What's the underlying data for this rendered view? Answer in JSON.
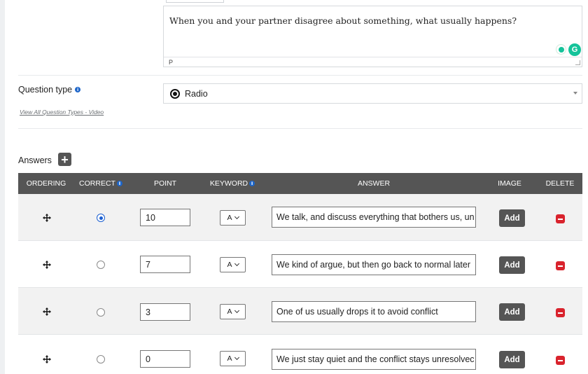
{
  "editor": {
    "content": "When you and your partner disagree about something, what usually happens?",
    "status_path": "P"
  },
  "question_type": {
    "label": "Question type",
    "link": "View All Question Types - Video",
    "selected": "Radio"
  },
  "answers": {
    "title": "Answers",
    "columns": {
      "ordering": "ORDERING",
      "correct": "CORRECT",
      "point": "POINT",
      "keyword": "KEYWORD",
      "answer": "ANSWER",
      "image": "IMAGE",
      "delete": "DELETE"
    },
    "image_button_label": "Add",
    "rows": [
      {
        "correct": true,
        "point": "10",
        "keyword": "A",
        "answer": "We talk, and discuss everything that bothers us, un"
      },
      {
        "correct": false,
        "point": "7",
        "keyword": "A",
        "answer": "We kind of argue, but then go back to normal later"
      },
      {
        "correct": false,
        "point": "3",
        "keyword": "A",
        "answer": "One of us usually drops it to avoid conflict"
      },
      {
        "correct": false,
        "point": "0",
        "keyword": "A",
        "answer": "We just stay quiet and the conflict stays unresolvec"
      }
    ]
  },
  "icons": {
    "move": "move-arrows-icon",
    "delete": "minus-square-icon",
    "info": "info-circle-icon",
    "add": "plus-square-icon",
    "grammarly": "grammarly-icon",
    "tip": "lightbulb-icon"
  },
  "colors": {
    "header_bg": "#555555",
    "delete_red": "#d9232d",
    "info_blue": "#1e66c9",
    "grammarly_green": "#15c39a"
  }
}
